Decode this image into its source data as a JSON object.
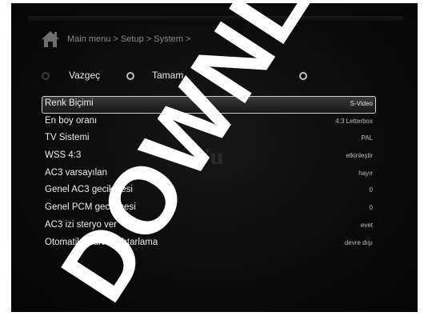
{
  "header": {
    "breadcrumb": "Main menu > Setup > System >",
    "icon": "home-icon"
  },
  "buttons": {
    "cancel_label": "Vazgeç",
    "ok_label": "Tamam"
  },
  "settings": [
    {
      "label": "Renk Biçimi",
      "value": "S-Video"
    },
    {
      "label": "En boy oranı",
      "value": "4:3 Letterbox"
    },
    {
      "label": "TV Sistemi",
      "value": "PAL"
    },
    {
      "label": "WSS 4:3",
      "value": "etkinleştir"
    },
    {
      "label": "AC3 varsayılan",
      "value": "hayır"
    },
    {
      "label": "Genel AC3 gecikmesi",
      "value": "0"
    },
    {
      "label": "Genel PCM gecikmesi",
      "value": "0"
    },
    {
      "label": "AC3 izi steryo ver",
      "value": "evet"
    },
    {
      "label": "Otomatik scart anahtarlama",
      "value": "devre dışı"
    }
  ],
  "selected_index": 0,
  "logo_text": "Vu",
  "watermark_text": "DOWNLOA",
  "colors": {
    "background": "#0b0b0b",
    "highlight_border": "#cfcfcf",
    "text": "#ececec"
  }
}
